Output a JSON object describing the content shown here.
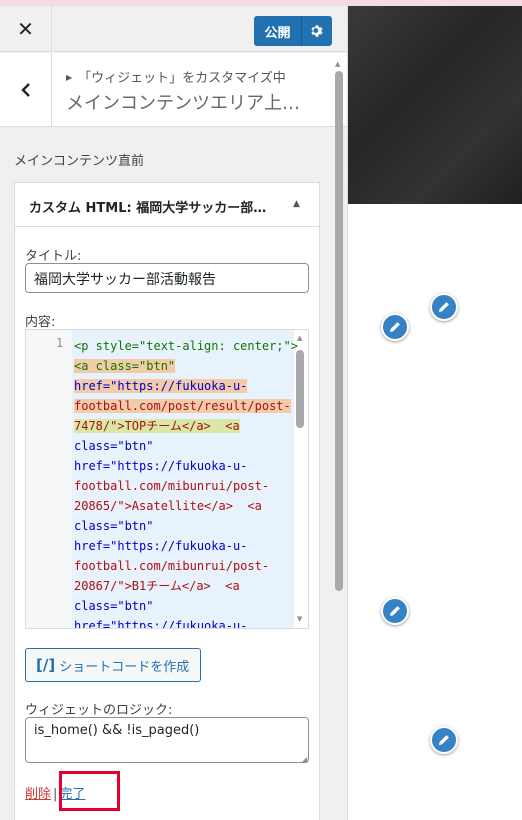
{
  "header": {
    "close_icon": "close-icon",
    "publish_label": "公開",
    "settings_icon": "gear-icon"
  },
  "section": {
    "breadcrumb": "「ウィジェット」をカスタマイズ中",
    "title": "メインコンテンツエリア上…"
  },
  "widget_area": {
    "title": "メインコンテンツ直前"
  },
  "widget": {
    "title": "カスタム HTML: 福岡大学サッカー部…",
    "title_label": "タイトル:",
    "title_value": "福岡大学サッカー部活動報告",
    "content_label": "内容:",
    "line_number": "1",
    "code_lines": [
      "<p style=\"text-align: center;\">",
      "<a class=\"btn\"",
      "href=\"https://fukuoka-u-",
      "football.com/post/result/post-",
      "7478/\">TOPチーム</a>  <a",
      "class=\"btn\"",
      "href=\"https://fukuoka-u-",
      "football.com/mibunrui/post-",
      "20865/\">Asatellite</a>  <a",
      "class=\"btn\"",
      "href=\"https://fukuoka-u-",
      "football.com/mibunrui/post-",
      "20867/\">B1チーム</a>  <a",
      "class=\"btn\"",
      "href=\"https://fukuoka-u-"
    ],
    "shortcode_icon": "[/]",
    "shortcode_label": "ショートコードを作成",
    "logic_label": "ウィジェットのロジック:",
    "logic_value": "is_home() && !is_paged()",
    "delete_label": "削除",
    "separator": "|",
    "done_label": "完了"
  },
  "colors": {
    "accent": "#2271b1",
    "delete": "#d63638",
    "highlight_box": "#e4002b",
    "code_bg": "#e8f2fc"
  }
}
